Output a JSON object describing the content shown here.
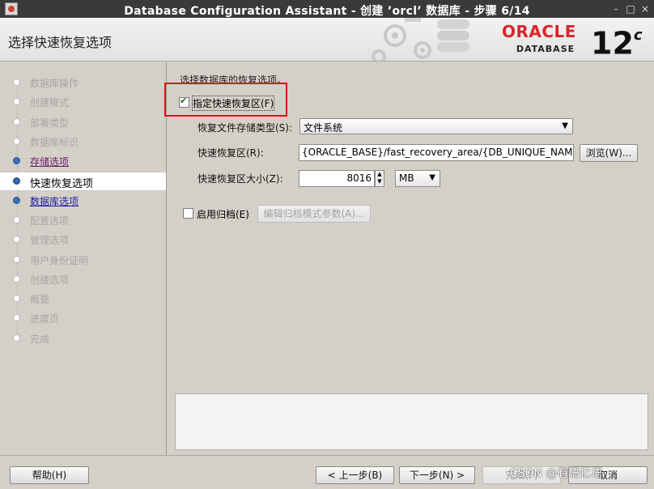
{
  "window": {
    "title": "Database Configuration Assistant - 创建 ’orcl’ 数据库 - 步骤 6/14",
    "controls": [
      "-",
      "□",
      "×"
    ]
  },
  "header": {
    "page_title": "选择快速恢复选项",
    "logo_oracle": "ORACLE",
    "logo_database": "DATABASE",
    "logo_version": "12",
    "logo_version_suffix": "c",
    "brand_color": "#d8262b"
  },
  "nav": {
    "items": [
      {
        "label": "数据库操作",
        "state": "disabled"
      },
      {
        "label": "创建模式",
        "state": "disabled"
      },
      {
        "label": "部署类型",
        "state": "disabled"
      },
      {
        "label": "数据库标识",
        "state": "disabled"
      },
      {
        "label": "存储选项",
        "state": "visited"
      },
      {
        "label": "快速恢复选项",
        "state": "current"
      },
      {
        "label": "数据库选项",
        "state": "visited"
      },
      {
        "label": "配置选项",
        "state": "disabled"
      },
      {
        "label": "管理选项",
        "state": "disabled"
      },
      {
        "label": "用户身份证明",
        "state": "disabled"
      },
      {
        "label": "创建选项",
        "state": "disabled"
      },
      {
        "label": "概要",
        "state": "disabled"
      },
      {
        "label": "进度页",
        "state": "disabled"
      },
      {
        "label": "完成",
        "state": "disabled"
      }
    ]
  },
  "content": {
    "intro": "选择数据库的恢复选项。",
    "fra_checkbox": {
      "label": "指定快速恢复区(F)",
      "checked": true
    },
    "storage_type": {
      "label": "恢复文件存储类型(S):",
      "value": "文件系统"
    },
    "fra_location": {
      "label": "快速恢复区(R):",
      "value": "{ORACLE_BASE}/fast_recovery_area/{DB_UNIQUE_NAME}",
      "browse": "浏览(W)..."
    },
    "fra_size": {
      "label": "快速恢复区大小(Z):",
      "value": "8016",
      "unit": "MB"
    },
    "archive_checkbox": {
      "label": "启用归档(E)",
      "checked": false
    },
    "archive_button": "编辑归档模式参数(A)..."
  },
  "footer": {
    "help": "帮助(H)",
    "back": "< 上一步(B)",
    "next": "下一步(N) >",
    "finish": "完成(F)",
    "cancel": "取消"
  },
  "watermark": "CSDN @有语忆语"
}
